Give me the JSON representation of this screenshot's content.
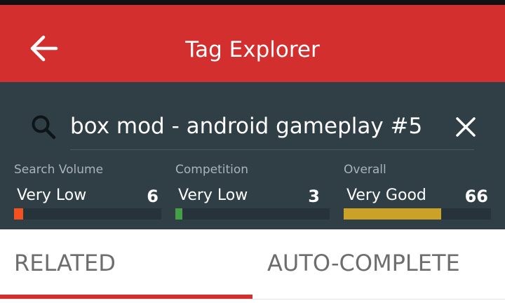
{
  "app_bar": {
    "title": "Tag Explorer",
    "back_icon": "arrow-left-icon",
    "color": "#d32f2f"
  },
  "search": {
    "value": "box mod - android gameplay #5",
    "search_icon": "magnifier-icon",
    "clear_icon": "close-icon"
  },
  "metrics": [
    {
      "label": "Search Volume",
      "rating": "Very Low",
      "value": "6",
      "fill_fraction": 0.06,
      "color": "#f4511e"
    },
    {
      "label": "Competition",
      "rating": "Very Low",
      "value": "3",
      "fill_fraction": 0.03,
      "color": "#43a047"
    },
    {
      "label": "Overall",
      "rating": "Very Good",
      "value": "66",
      "fill_fraction": 0.66,
      "color": "#c9a227"
    }
  ],
  "tabs": [
    {
      "label": "RELATED",
      "selected": true
    },
    {
      "label": "AUTO-COMPLETE",
      "selected": false
    }
  ]
}
